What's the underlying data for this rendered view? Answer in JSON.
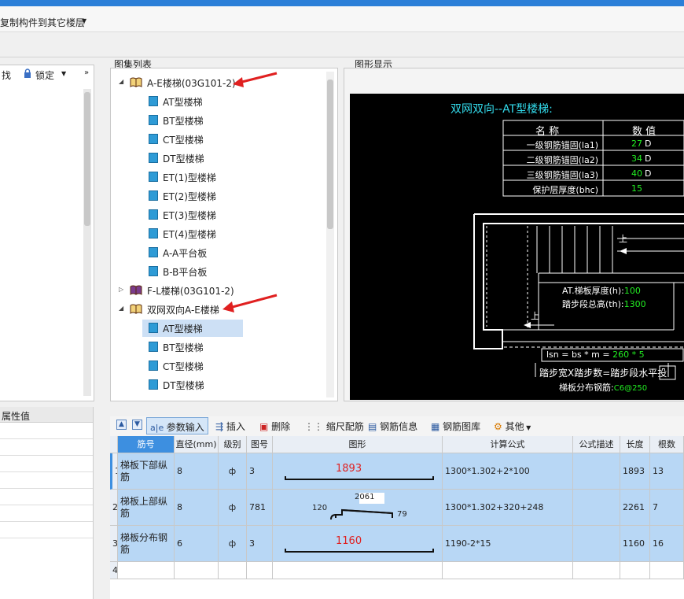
{
  "menubar": {
    "item": "复制构件到其它楼层",
    "dropdown": "▼"
  },
  "left_toolbar": {
    "find": "找",
    "lock": "锁定"
  },
  "properties": {
    "header": "属性值"
  },
  "atlas": {
    "title": "图集列表",
    "groups": [
      {
        "label": "A-E楼梯(03G101-2)",
        "expanded": true,
        "items": [
          "AT型楼梯",
          "BT型楼梯",
          "CT型楼梯",
          "DT型楼梯",
          "ET(1)型楼梯",
          "ET(2)型楼梯",
          "ET(3)型楼梯",
          "ET(4)型楼梯",
          "A-A平台板",
          "B-B平台板"
        ]
      },
      {
        "label": "F-L楼梯(03G101-2)",
        "expanded": false,
        "items": []
      },
      {
        "label": "双网双向A-E楼梯",
        "expanded": true,
        "items": [
          "AT型楼梯",
          "BT型楼梯",
          "CT型楼梯",
          "DT型楼梯"
        ],
        "selected": "AT型楼梯"
      }
    ]
  },
  "preview": {
    "title": "图形显示",
    "drawing_title": "双网双向--AT型楼梯:",
    "table_headers": [
      "名 称",
      "数 值"
    ],
    "table_rows": [
      {
        "name": "一级钢筋锚固(la1)",
        "value": "27",
        "unit": "D"
      },
      {
        "name": "二级钢筋锚固(la2)",
        "value": "34",
        "unit": "D"
      },
      {
        "name": "三级钢筋锚固(la3)",
        "value": "40",
        "unit": "D"
      },
      {
        "name": "保护层厚度(bhc)",
        "value": "15",
        "unit": ""
      }
    ],
    "thickness_label": "AT.梯板厚度(h):",
    "thickness_value": "100",
    "height_label": "踏步段总高(th):",
    "height_value": "1300",
    "lsn_prefix": "lsn = bs * m = ",
    "lsn_value": "260 * 5",
    "step_text": "踏步宽X踏步数=踏步段水平",
    "step_text2": "投",
    "dist_label": "梯板分布钢筋:",
    "dist_value": "C6@250",
    "marker": "上"
  },
  "toolbar": {
    "param_input": "参数输入",
    "insert": "插入",
    "delete": "删除",
    "scale_rebar": "缩尺配筋",
    "rebar_info": "钢筋信息",
    "rebar_library": "钢筋图库",
    "other": "其他"
  },
  "grid": {
    "headers": [
      "筋号",
      "直径(mm)",
      "级别",
      "图号",
      "图形",
      "计算公式",
      "公式描述",
      "长度",
      "根数"
    ],
    "rows": [
      {
        "no": "1",
        "name": "梯板下部纵筋",
        "dia": "8",
        "grade": "ф",
        "fig": "3",
        "shape_value": "1893",
        "formula": "1300*1.302+2*100",
        "desc": "",
        "length": "1893",
        "count": "13"
      },
      {
        "no": "2",
        "name": "梯板上部纵筋",
        "dia": "8",
        "grade": "ф",
        "fig": "781",
        "shape_left": "120",
        "shape_top": "2061",
        "shape_right": "79",
        "formula": "1300*1.302+320+248",
        "desc": "",
        "length": "2261",
        "count": "7"
      },
      {
        "no": "3",
        "name": "梯板分布钢筋",
        "dia": "6",
        "grade": "ф",
        "fig": "3",
        "shape_value": "1160",
        "formula": "1190-2*15",
        "desc": "",
        "length": "1160",
        "count": "16"
      },
      {
        "no": "4"
      }
    ]
  },
  "colors": {
    "accent": "#2b7fd8",
    "row_selected": "#b8d7f5",
    "drawing_cyan": "#33ddee",
    "drawing_green": "#22ee22",
    "annotation_red": "#e02020"
  }
}
